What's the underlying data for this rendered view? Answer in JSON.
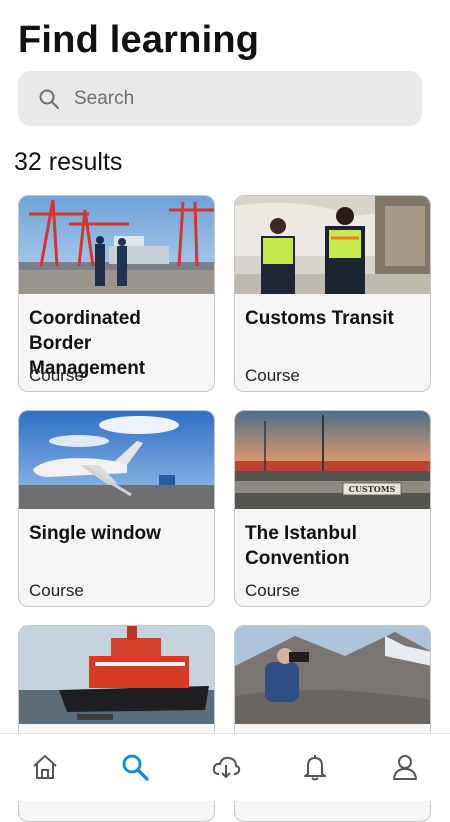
{
  "page": {
    "title": "Find learning"
  },
  "search": {
    "placeholder": "Search",
    "value": ""
  },
  "results": {
    "count_text": "32 results"
  },
  "cards": [
    {
      "title": "Coordinated Border Management",
      "type": "Course"
    },
    {
      "title": "Customs Transit",
      "type": "Course"
    },
    {
      "title": "Single window",
      "type": "Course"
    },
    {
      "title": "The Istanbul Convention",
      "type": "Course"
    },
    {
      "title": "",
      "type": ""
    },
    {
      "title": "",
      "type": ""
    }
  ],
  "image_labels": {
    "customs_sign": "CUSTOMS"
  },
  "nav": {
    "items": [
      {
        "icon": "home-icon",
        "active": false
      },
      {
        "icon": "search-icon",
        "active": true
      },
      {
        "icon": "download-cloud-icon",
        "active": false
      },
      {
        "icon": "bell-icon",
        "active": false
      },
      {
        "icon": "profile-icon",
        "active": false
      }
    ],
    "active_color": "#1a8fcf",
    "inactive_color": "#555555"
  },
  "colors": {
    "search_bg": "#e9e9ea",
    "card_bg": "#f6f6f6",
    "card_border": "#c8c8c8"
  }
}
